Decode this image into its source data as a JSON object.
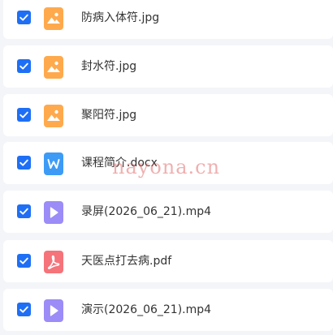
{
  "files": [
    {
      "name": "防病入体符.jpg",
      "checked": true,
      "type": "image",
      "icon": "image-file-icon"
    },
    {
      "name": "封水符.jpg",
      "checked": true,
      "type": "image",
      "icon": "image-file-icon"
    },
    {
      "name": "聚阳符.jpg",
      "checked": true,
      "type": "image",
      "icon": "image-file-icon"
    },
    {
      "name": "课程简介.docx",
      "checked": true,
      "type": "word",
      "icon": "word-file-icon"
    },
    {
      "name": "录屏(2026_06_21).mp4",
      "checked": true,
      "type": "video",
      "icon": "video-file-icon"
    },
    {
      "name": "天医点打去病.pdf",
      "checked": true,
      "type": "pdf",
      "icon": "pdf-file-icon"
    },
    {
      "name": "演示(2026_06_21).mp4",
      "checked": true,
      "type": "video",
      "icon": "video-file-icon"
    }
  ],
  "colors": {
    "checkbox": "#1e6ff5",
    "image": "#ffa94d",
    "word": "#3d9bf6",
    "video": "#9b8cf7",
    "pdf": "#f5737a"
  },
  "watermark": "nayona.cn"
}
